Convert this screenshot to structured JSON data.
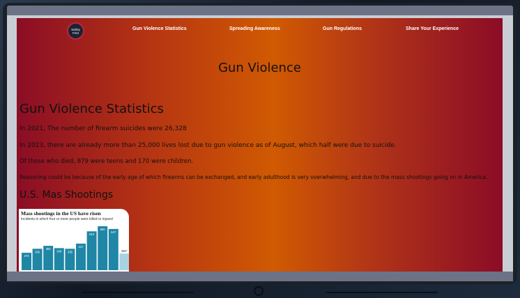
{
  "nav": {
    "logo_line1": "Safety",
    "logo_line2": "First",
    "links": [
      "Gun Violence Statistics",
      "Spreading Awareness",
      "Gun Regulations",
      "Share Your Experience"
    ]
  },
  "main": {
    "title": "Gun Violence",
    "stats_heading": "Gun Violence Statistics",
    "paragraphs": [
      "In 2021, The number of firearm suicides were 26,328",
      "In 2023, there are already more than 25,000 lives lost due to gun violence as of August, which half were due to suicide.",
      "Of those who died, 879 were teens and 170 were children.",
      "Reasoning could be because of the early age of which firearms can be exchanged, and early adulthood is very overwhelming, and due to the mass shootings going on in America."
    ],
    "mass_heading": "U.S. Mas Shootings"
  },
  "chart_data": {
    "type": "bar",
    "title": "Mass shootings in the US have risen",
    "subtitle": "Incidents in which four or more people were killed or injured",
    "labels": [
      "273",
      "336",
      "382",
      "346",
      "336",
      "417",
      "610",
      "690",
      "647",
      "261*"
    ],
    "values": [
      273,
      336,
      382,
      346,
      336,
      417,
      610,
      690,
      647,
      261
    ],
    "colors": {
      "bar": "#1f86a6",
      "partial": "#a9d3e3"
    }
  },
  "colors": {
    "gradient": [
      "#8b0d25",
      "#b63512",
      "#d05a02",
      "#b03318",
      "#8b0c26"
    ],
    "logo_bg": "#1d2233",
    "logo_ring": "#b8283e"
  }
}
